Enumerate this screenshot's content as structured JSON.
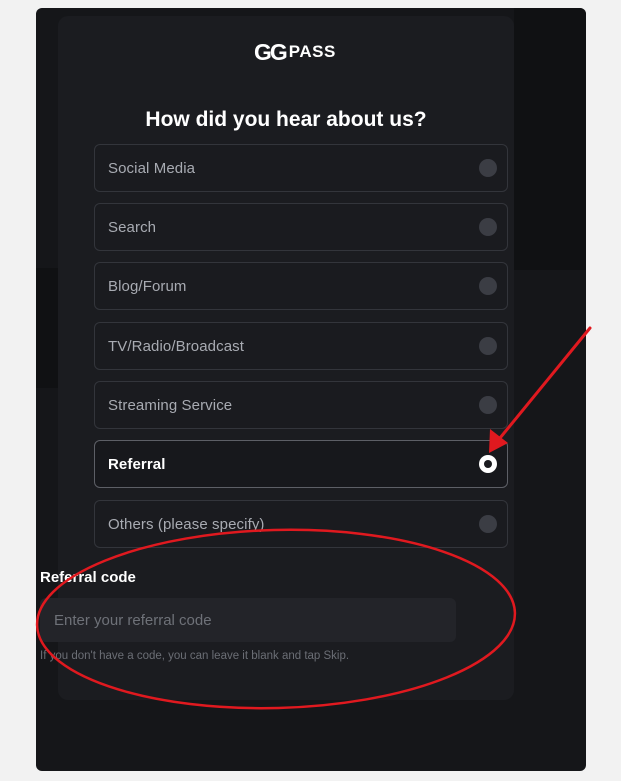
{
  "brand": {
    "logo_mark": "GG",
    "logo_word": "PASS"
  },
  "survey": {
    "title": "How did you hear about us?",
    "selected_option": "Referral",
    "options": [
      {
        "label": "Social Media",
        "selected": false
      },
      {
        "label": "Search",
        "selected": false
      },
      {
        "label": "Blog/Forum",
        "selected": false
      },
      {
        "label": "TV/Radio/Broadcast",
        "selected": false
      },
      {
        "label": "Streaming Service",
        "selected": false
      },
      {
        "label": "Referral",
        "selected": true
      },
      {
        "label": "Others (please specify)",
        "selected": false
      }
    ]
  },
  "referral": {
    "label": "Referral code",
    "value": "",
    "placeholder": "Enter your referral code",
    "hint": "If you don't have a code, you can leave it blank and tap Skip."
  },
  "annotation": {
    "color": "#e0191f",
    "shapes": [
      "arrow",
      "ellipse"
    ]
  },
  "colors": {
    "page_background": "#f2f2f2",
    "card_background": "#1b1c20",
    "option_border": "#33353b",
    "radio_off": "#3b3d44",
    "radio_on": "#ffffff"
  }
}
